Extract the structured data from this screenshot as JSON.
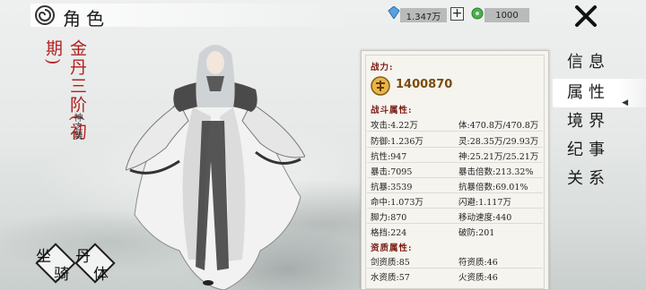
{
  "header": {
    "title": "角色"
  },
  "currency": {
    "gem_amount": "1.347万",
    "plus_label": "+",
    "jade_amount": "1000",
    "gem_color": "#5aa0e0",
    "jade_color": "#4caf50"
  },
  "menu": {
    "items": [
      {
        "label": "信息",
        "active": false
      },
      {
        "label": "属性",
        "active": true
      },
      {
        "label": "境界",
        "active": false
      },
      {
        "label": "纪事",
        "active": false
      },
      {
        "label": "关系",
        "active": false
      }
    ],
    "arrow": "◀"
  },
  "character": {
    "rank": "金丹三阶",
    "stage": "(初期)",
    "title": "神之舞"
  },
  "buttons": {
    "mount": [
      "坐",
      "骑"
    ],
    "body": [
      "丹",
      "体"
    ]
  },
  "panel": {
    "power_label": "战力:",
    "power_value": "1400870",
    "combat_label": "战斗属性:",
    "combat": [
      [
        "攻击:4.22万",
        "体:470.8万/470.8万"
      ],
      [
        "防御:1.236万",
        "灵:28.35万/29.93万"
      ],
      [
        "抗性:947",
        "神:25.21万/25.21万"
      ],
      [
        "暴击:7095",
        "暴击倍数:213.32%"
      ],
      [
        "抗暴:3539",
        "抗暴倍数:69.01%"
      ],
      [
        "命中:1.073万",
        "闪避:1.117万"
      ],
      [
        "脚力:870",
        "移动速度:440"
      ],
      [
        "格挡:224",
        "破防:201"
      ]
    ],
    "aptitude_label": "资质属性:",
    "aptitude": [
      [
        "剑资质:85",
        "符资质:46"
      ],
      [
        "水资质:57",
        "火资质:46"
      ]
    ]
  },
  "colors": {
    "rank_red": "#b41f1f",
    "section_red": "#7a1a12",
    "power_gold": "#7a4c0e"
  }
}
